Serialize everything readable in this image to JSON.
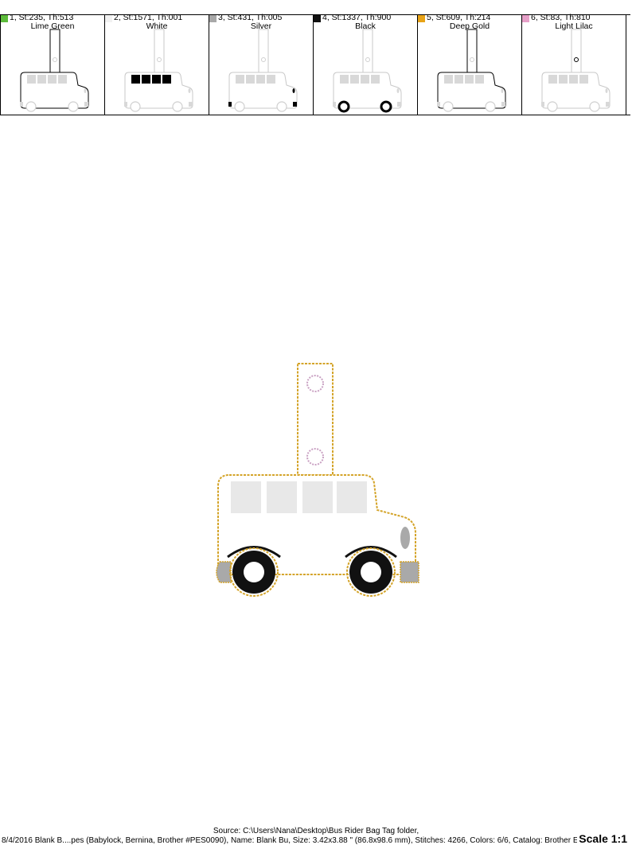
{
  "colors_list": [
    {
      "info": "1, St:235, Th:513",
      "name": "Lime Green",
      "chip": "#5dbb3b",
      "element": "outline",
      "stroke": "#000000"
    },
    {
      "info": "2, St:1571, Th:001",
      "name": "White",
      "chip": "#f2f2f2",
      "element": "windows",
      "stroke": "#000000"
    },
    {
      "info": "3, St:431, Th:005",
      "name": "Silver",
      "chip": "#a8a8a8",
      "element": "lights",
      "stroke": "#000000"
    },
    {
      "info": "4, St:1337, Th:900",
      "name": "Black",
      "chip": "#111111",
      "element": "wheels",
      "stroke": "#000000"
    },
    {
      "info": "5, St:609, Th:214",
      "name": "Deep Gold",
      "chip": "#e8a317",
      "element": "outline",
      "stroke": "#000000"
    },
    {
      "info": "6, St:83, Th:810",
      "name": "Light Lilac",
      "chip": "#e6a0c8",
      "element": "holes",
      "stroke": "#000000"
    }
  ],
  "design_colors": {
    "outline": "#d4a42a",
    "window": "#e8e8e8",
    "silver": "#a9a9a9",
    "black": "#111111",
    "lilac": "#c9a0c2"
  },
  "footer": {
    "source": "Source: C:\\Users\\Nana\\Desktop\\Bus Rider Bag Tag folder,",
    "details": "8/4/2016 Blank B....pes (Babylock, Bernina, Brother #PES0090), Name: Blank Bu, Size: 3.42x3.88 \" (86.8x98.6 mm), Stitches: 4266, Colors: 6/6, Catalog: Brother Embroidery",
    "scale": "Scale 1:1"
  }
}
